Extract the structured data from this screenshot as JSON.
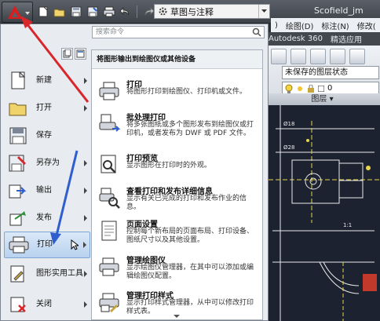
{
  "title_bar": {
    "workspace_label": "草图与注释",
    "document_title": "Scofield_jm"
  },
  "quick_access": {
    "icons": [
      "new-icon",
      "open-icon",
      "save-icon",
      "save-as-icon",
      "print-icon",
      "undo-icon",
      "redo-icon"
    ]
  },
  "menubar": {
    "items": [
      ")",
      "绘图(D)",
      "标注(N)",
      "修改("
    ]
  },
  "ribbon": {
    "tabs": [
      "Autodesk 360",
      "精选应用"
    ],
    "layer_state": "未保存的图层状态",
    "layer_value": "0",
    "panel_label": "图层 ▾"
  },
  "app_menu": {
    "search_placeholder": "搜索命令",
    "left_items": [
      {
        "label": "新建",
        "icon": "new-icon",
        "has_submenu": true
      },
      {
        "label": "打开",
        "icon": "open-icon",
        "has_submenu": true
      },
      {
        "label": "保存",
        "icon": "save-icon",
        "has_submenu": false
      },
      {
        "label": "另存为",
        "icon": "save-as-icon",
        "has_submenu": true
      },
      {
        "label": "输出",
        "icon": "export-icon",
        "has_submenu": true
      },
      {
        "label": "发布",
        "icon": "publish-icon",
        "has_submenu": true
      },
      {
        "label": "打印",
        "icon": "print-icon",
        "has_submenu": true,
        "active": true
      },
      {
        "label": "图形实用工具",
        "icon": "drawing-utilities-icon",
        "has_submenu": true
      },
      {
        "label": "关闭",
        "icon": "close-icon",
        "has_submenu": true
      }
    ],
    "submenu": {
      "header": "将图形输出到绘图仪或其他设备",
      "items": [
        {
          "title": "打印",
          "desc": "将图形打印到绘图仪、打印机或文件。",
          "icon": "print-icon"
        },
        {
          "title": "批处理打印",
          "desc": "将多张图纸或多个图形发布到绘图仪或打印机，或者发布为 DWF 或 PDF 文件。",
          "icon": "batch-plot-icon"
        },
        {
          "title": "打印预览",
          "desc": "显示图形在打印时的外观。",
          "icon": "plot-preview-icon"
        },
        {
          "title": "查看打印和发布详细信息",
          "desc": "显示有关已完成的打印和发布作业的信息。",
          "icon": "plot-details-icon"
        },
        {
          "title": "页面设置",
          "desc": "控制每个新布局的页面布局、打印设备、图纸尺寸以及其他设置。",
          "icon": "page-setup-icon"
        },
        {
          "title": "管理绘图仪",
          "desc": "显示绘图仪管理器，在其中可以添加或编辑绘图仪配置。",
          "icon": "plotter-manager-icon"
        },
        {
          "title": "管理打印样式",
          "desc": "显示打印样式管理器，从中可以修改打印样式表。",
          "icon": "plot-style-icon"
        }
      ]
    }
  },
  "colors": {
    "annotation_red": "#d9262b",
    "annotation_blue": "#2f5fcf",
    "canvas_bg": "#1c2230",
    "cad_lines": "#eaeaea",
    "cad_accent": "#e8d44d"
  }
}
